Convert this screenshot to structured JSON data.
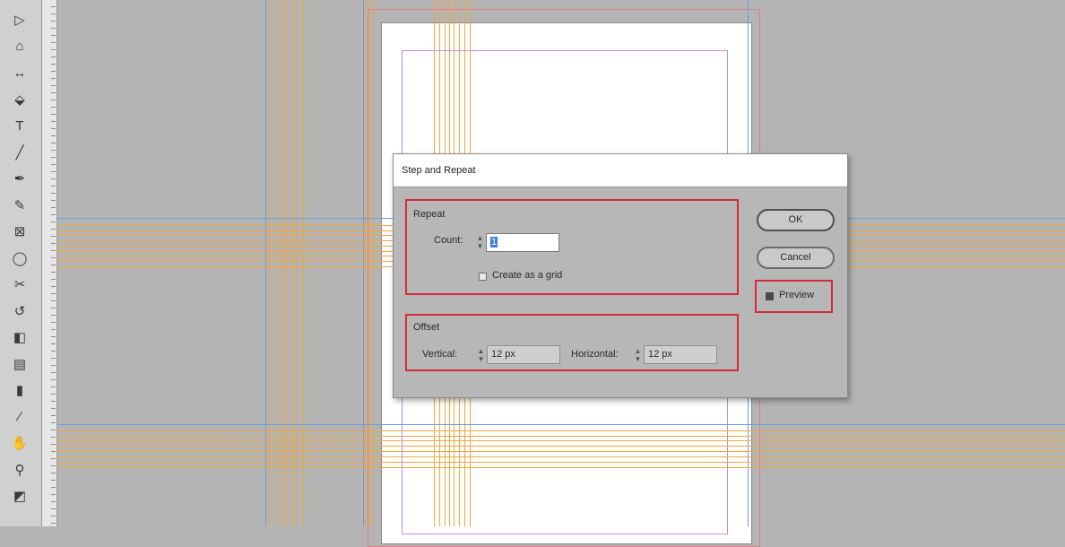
{
  "toolbar": {
    "tools": [
      {
        "icon": "selection-tool-icon",
        "glyph": "▷"
      },
      {
        "icon": "page-tool-icon",
        "glyph": "⌂"
      },
      {
        "icon": "gap-tool-icon",
        "glyph": "↔"
      },
      {
        "icon": "content-collector-icon",
        "glyph": "⬙"
      },
      {
        "icon": "type-tool-icon",
        "glyph": "T"
      },
      {
        "icon": "line-tool-icon",
        "glyph": "╱"
      },
      {
        "icon": "pen-tool-icon",
        "glyph": "✒"
      },
      {
        "icon": "pencil-tool-icon",
        "glyph": "✎"
      },
      {
        "icon": "rectangle-frame-tool-icon",
        "glyph": "⊠"
      },
      {
        "icon": "ellipse-tool-icon",
        "glyph": "◯"
      },
      {
        "icon": "scissors-tool-icon",
        "glyph": "✂"
      },
      {
        "icon": "rotate-tool-icon",
        "glyph": "↺"
      },
      {
        "icon": "gradient-swatch-tool-icon",
        "glyph": "◧"
      },
      {
        "icon": "gradient-feather-tool-icon",
        "glyph": "▤"
      },
      {
        "icon": "note-tool-icon",
        "glyph": "▮"
      },
      {
        "icon": "eyedropper-tool-icon",
        "glyph": "⁄"
      },
      {
        "icon": "hand-tool-icon",
        "glyph": "✋"
      },
      {
        "icon": "zoom-tool-icon",
        "glyph": "⚲"
      },
      {
        "icon": "fill-stroke-icon",
        "glyph": "◩"
      }
    ]
  },
  "colors": {
    "guide_orange": "#f0a640",
    "guide_blue": "#6a9ee0",
    "highlight_red": "#d42a3a",
    "margin_violet": "#c68be8",
    "bleed_pink": "#e07b86"
  },
  "dialog": {
    "title": "Step and Repeat",
    "repeat": {
      "label": "Repeat",
      "count_label": "Count:",
      "count_value": "1",
      "create_grid_label": "Create as a grid",
      "create_grid_checked": false
    },
    "offset": {
      "label": "Offset",
      "vertical_label": "Vertical:",
      "vertical_value": "12 px",
      "horizontal_label": "Horizontal:",
      "horizontal_value": "12 px"
    },
    "ok_label": "OK",
    "cancel_label": "Cancel",
    "preview_label": "Preview",
    "preview_checked": true
  }
}
